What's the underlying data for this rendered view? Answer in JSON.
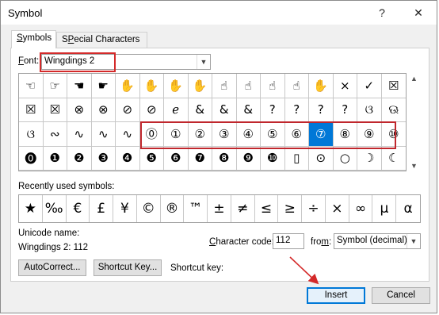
{
  "window": {
    "title": "Symbol",
    "help_label": "?",
    "close_label": "✕"
  },
  "tabs": [
    {
      "label": "Symbols",
      "underline": "S",
      "rest": "ymbols"
    },
    {
      "label": "Special Characters",
      "underline": "P",
      "pre": "S",
      "rest": "ecial Characters"
    }
  ],
  "font": {
    "label_u": "F",
    "label_rest": "ont:",
    "value": "Wingdings 2"
  },
  "symbols": [
    "☜",
    "☞",
    "☚",
    "☛",
    "✋",
    "✋",
    "✋",
    "✋",
    "☝",
    "☝",
    "☝",
    "☝",
    "✋",
    "×",
    "✓",
    "☒",
    "☒",
    "☒",
    "⊗",
    "⊗",
    "⊘",
    "⊘",
    "ℯ",
    "&",
    "&",
    "&",
    "?",
    "?",
    "?",
    "?",
    "ଓ",
    "ଊ",
    "ଓ",
    "∾",
    "∿",
    "∿",
    "∿",
    "⓪",
    "①",
    "②",
    "③",
    "④",
    "⑤",
    "⑥",
    "⑦",
    "⑧",
    "⑨",
    "⑩",
    "⓿",
    "❶",
    "❷",
    "❸",
    "❹",
    "❺",
    "❻",
    "❼",
    "❽",
    "❾",
    "❿",
    "▯",
    "⊙",
    "○",
    "☽",
    "☾"
  ],
  "selected_index": 44,
  "last_row_extra": [
    "❡",
    "✝"
  ],
  "recent": {
    "label": "Recently used symbols:",
    "items": [
      "★",
      "‰",
      "€",
      "£",
      "¥",
      "©",
      "®",
      "™",
      "±",
      "≠",
      "≤",
      "≥",
      "÷",
      "×",
      "∞",
      "μ",
      "α"
    ]
  },
  "unicode": {
    "label": "Unicode name:",
    "value": "Wingdings 2: 112"
  },
  "char_code": {
    "label_u": "C",
    "label_pre": "",
    "label_rest": "haracter code:",
    "value": "112"
  },
  "from": {
    "label_u": "m",
    "label_pre": "fro",
    "label_rest": ":",
    "value": "Symbol (decimal)"
  },
  "buttons": {
    "autocorrect": "AutoCorrect...",
    "shortcut_key": "Shortcut Key...",
    "insert": "Insert",
    "cancel": "Cancel"
  },
  "shortcut_label": "Shortcut key:",
  "colors": {
    "selection": "#0078d7",
    "highlight": "#c0272d"
  }
}
